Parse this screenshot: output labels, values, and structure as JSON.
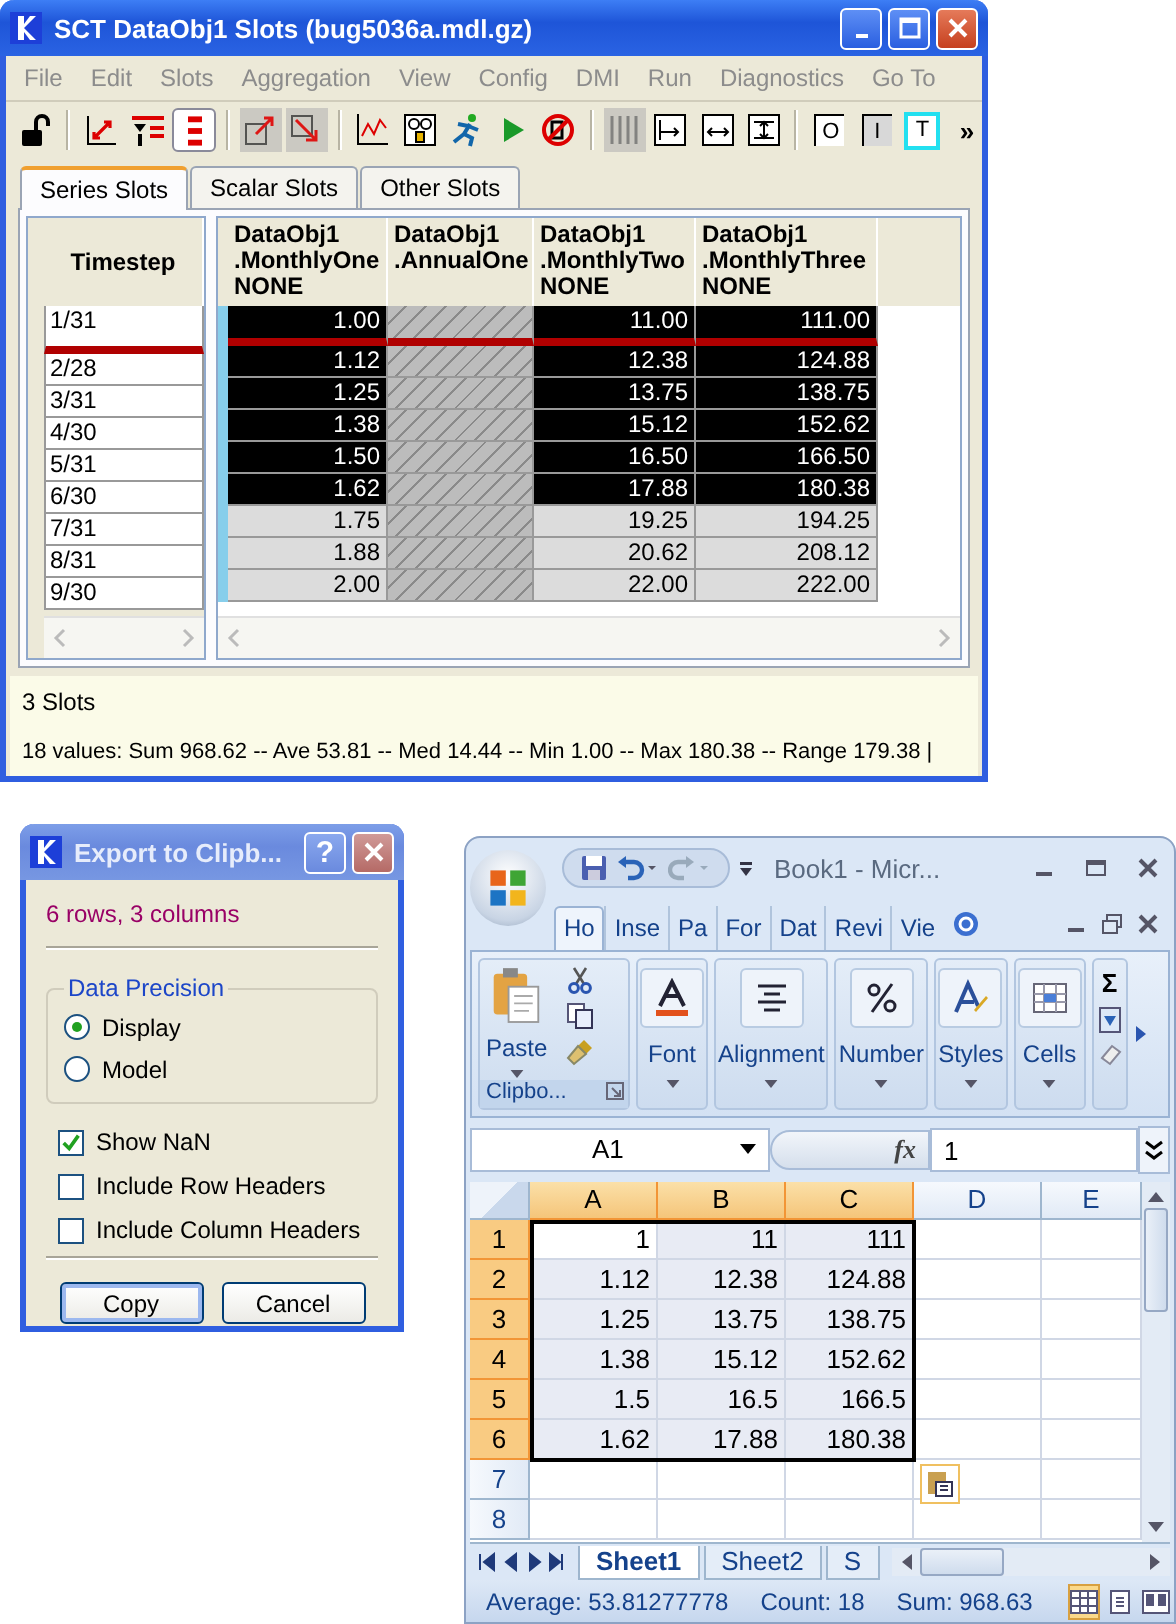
{
  "main_window": {
    "title": "SCT DataObj1 Slots (bug5036a.mdl.gz)",
    "menu": [
      "File",
      "Edit",
      "Slots",
      "Aggregation",
      "View",
      "Config",
      "DMI",
      "Run",
      "Diagnostics",
      "Go To"
    ],
    "toolbar": [
      [
        {
          "kind": "lock",
          "pressed": false,
          "disabled": false
        }
      ],
      [
        {
          "kind": "swap",
          "pressed": false,
          "disabled": false
        },
        {
          "kind": "filter",
          "pressed": false,
          "disabled": false
        },
        {
          "kind": "rows",
          "pressed": true,
          "disabled": false
        }
      ],
      [
        {
          "kind": "export",
          "pressed": false,
          "disabled": true
        },
        {
          "kind": "import",
          "pressed": false,
          "disabled": true
        }
      ],
      [
        {
          "kind": "plot",
          "pressed": false,
          "disabled": false
        },
        {
          "kind": "gauge",
          "pressed": false,
          "disabled": false
        },
        {
          "kind": "runner",
          "pressed": false,
          "disabled": false
        },
        {
          "kind": "play",
          "pressed": false,
          "disabled": false
        },
        {
          "kind": "stop",
          "pressed": false,
          "disabled": false
        }
      ],
      [
        {
          "kind": "columns",
          "pressed": false,
          "disabled": true
        },
        {
          "kind": "fit_left",
          "pressed": false,
          "disabled": false
        },
        {
          "kind": "fit_width",
          "pressed": false,
          "disabled": false
        },
        {
          "kind": "fit_both",
          "pressed": false,
          "disabled": false
        }
      ],
      [
        {
          "kind": "letter",
          "text": "O",
          "pressed": false,
          "disabled": false
        },
        {
          "kind": "letter",
          "text": "I",
          "pressed": false,
          "disabled": false
        },
        {
          "kind": "letter",
          "text": "T",
          "pressed": false,
          "disabled": false
        }
      ]
    ],
    "overflow": "»",
    "tabs": [
      {
        "label": "Series Slots",
        "selected": true
      },
      {
        "label": "Scalar Slots",
        "selected": false
      },
      {
        "label": "Other Slots",
        "selected": false
      }
    ],
    "timestep_header": "Timestep",
    "columns": [
      {
        "kind": "series",
        "lines": [
          "DataObj1",
          ".MonthlyOne",
          "NONE"
        ]
      },
      {
        "kind": "scalar",
        "lines": [
          "DataObj1",
          ".AnnualOne"
        ]
      },
      {
        "kind": "series",
        "lines": [
          "DataObj1",
          ".MonthlyTwo",
          "NONE"
        ]
      },
      {
        "kind": "series",
        "lines": [
          "DataObj1",
          ".MonthlyThree",
          "NONE"
        ]
      }
    ],
    "rows": [
      {
        "timestep": "1/31",
        "selected": true,
        "current": true,
        "values": [
          "1.00",
          "11.00",
          "111.00"
        ]
      },
      {
        "timestep": "2/28",
        "selected": true,
        "current": false,
        "values": [
          "1.12",
          "12.38",
          "124.88"
        ]
      },
      {
        "timestep": "3/31",
        "selected": true,
        "current": false,
        "values": [
          "1.25",
          "13.75",
          "138.75"
        ]
      },
      {
        "timestep": "4/30",
        "selected": true,
        "current": false,
        "values": [
          "1.38",
          "15.12",
          "152.62"
        ]
      },
      {
        "timestep": "5/31",
        "selected": true,
        "current": false,
        "values": [
          "1.50",
          "16.50",
          "166.50"
        ]
      },
      {
        "timestep": "6/30",
        "selected": true,
        "current": false,
        "values": [
          "1.62",
          "17.88",
          "180.38"
        ]
      },
      {
        "timestep": "7/31",
        "selected": false,
        "current": false,
        "values": [
          "1.75",
          "19.25",
          "194.25"
        ]
      },
      {
        "timestep": "8/31",
        "selected": false,
        "current": false,
        "values": [
          "1.88",
          "20.62",
          "208.12"
        ]
      },
      {
        "timestep": "9/30",
        "selected": false,
        "current": false,
        "values": [
          "2.00",
          "22.00",
          "222.00"
        ]
      }
    ],
    "slot_count": "3 Slots",
    "statistics": "18 values:  Sum 968.62 -- Ave 53.81 -- Med 14.44 -- Min 1.00 -- Max 180.38 -- Range 179.38 |"
  },
  "dialog": {
    "title": "Export to Clipb...",
    "help": "?",
    "summary": "6 rows, 3 columns",
    "precision": {
      "label": "Data Precision",
      "options": [
        {
          "label": "Display",
          "selected": true
        },
        {
          "label": "Model",
          "selected": false
        }
      ]
    },
    "options": [
      {
        "label": "Show NaN",
        "checked": true
      },
      {
        "label": "Include Row Headers",
        "checked": false
      },
      {
        "label": "Include Column Headers",
        "checked": false
      }
    ],
    "buttons": [
      {
        "label": "Copy",
        "default": true
      },
      {
        "label": "Cancel",
        "default": false
      }
    ]
  },
  "excel": {
    "title": "Book1 - Micr...",
    "ribbon_tabs": [
      {
        "label": "Ho",
        "selected": true
      },
      {
        "label": "Inse",
        "selected": false
      },
      {
        "label": "Pa",
        "selected": false
      },
      {
        "label": "For",
        "selected": false
      },
      {
        "label": "Dat",
        "selected": false
      },
      {
        "label": "Revi",
        "selected": false
      },
      {
        "label": "Vie",
        "selected": false
      }
    ],
    "paste": "Paste",
    "clipboard_label": "Clipbo...",
    "groups": [
      {
        "kind": "font",
        "label": "Font"
      },
      {
        "kind": "alignment",
        "label": "Alignment"
      },
      {
        "kind": "number",
        "label": "Number"
      },
      {
        "kind": "styles",
        "label": "Styles"
      },
      {
        "kind": "cells",
        "label": "Cells"
      }
    ],
    "editing_symbol": "Σ",
    "name_box": "A1",
    "fx": "fx",
    "formula": "1",
    "columns": [
      {
        "label": "A",
        "selected": true
      },
      {
        "label": "B",
        "selected": true
      },
      {
        "label": "C",
        "selected": true
      },
      {
        "label": "D",
        "selected": false
      },
      {
        "label": "E",
        "selected": false
      }
    ],
    "rows": [
      {
        "label": "1",
        "selected": true,
        "cells": [
          "1",
          "11",
          "111"
        ]
      },
      {
        "label": "2",
        "selected": true,
        "cells": [
          "1.12",
          "12.38",
          "124.88"
        ]
      },
      {
        "label": "3",
        "selected": true,
        "cells": [
          "1.25",
          "13.75",
          "138.75"
        ]
      },
      {
        "label": "4",
        "selected": true,
        "cells": [
          "1.38",
          "15.12",
          "152.62"
        ]
      },
      {
        "label": "5",
        "selected": true,
        "cells": [
          "1.5",
          "16.5",
          "166.5"
        ]
      },
      {
        "label": "6",
        "selected": true,
        "cells": [
          "1.62",
          "17.88",
          "180.38"
        ]
      },
      {
        "label": "7",
        "selected": false
      },
      {
        "label": "8",
        "selected": false
      }
    ],
    "sheets": [
      {
        "label": "Sheet1",
        "selected": true
      },
      {
        "label": "Sheet2",
        "selected": false
      },
      {
        "label": "S",
        "selected": false
      }
    ],
    "status": [
      "Average: 53.81277778",
      "Count: 18",
      "Sum: 968.63"
    ],
    "views": [
      {
        "kind": "normal",
        "selected": true
      },
      {
        "kind": "layout",
        "selected": false
      },
      {
        "kind": "break",
        "selected": false
      }
    ]
  }
}
